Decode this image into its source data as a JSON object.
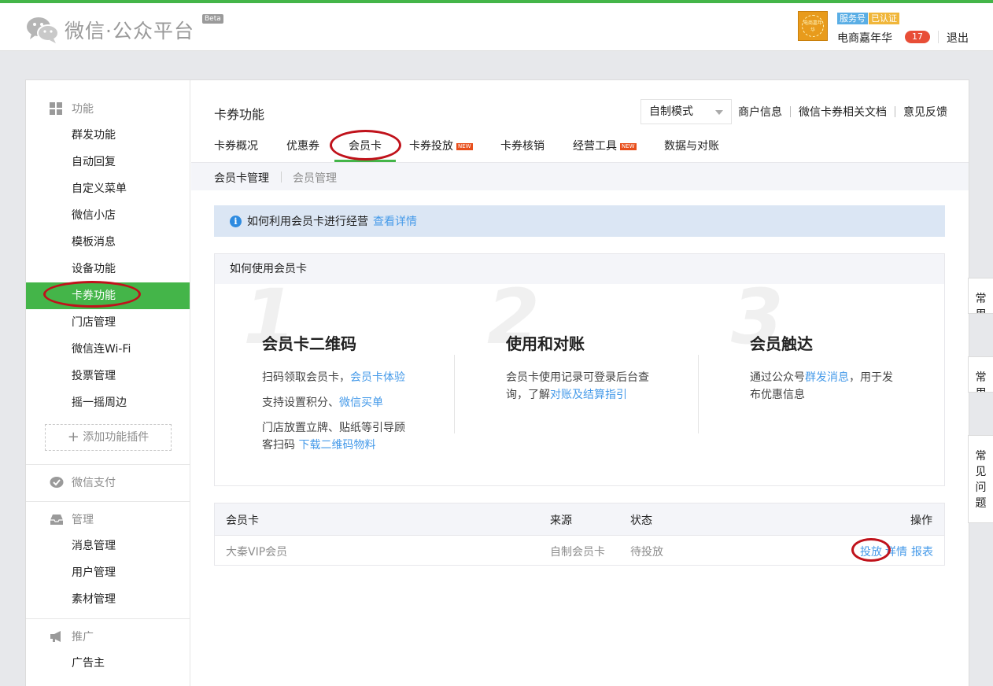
{
  "header": {
    "logo_text": "微信·公众平台",
    "beta": "Beta",
    "avatar_text": "电商嘉年华",
    "badge_service": "服务号",
    "badge_verified": "已认证",
    "account_name": "电商嘉年华",
    "message_count": "17",
    "logout": "退出"
  },
  "sidebar": {
    "group_function": "功能",
    "function_items": [
      "群发功能",
      "自动回复",
      "自定义菜单",
      "微信小店",
      "模板消息",
      "设备功能",
      "卡券功能",
      "门店管理",
      "微信连Wi-Fi",
      "投票管理",
      "摇一摇周边"
    ],
    "add_plugin": "添加功能插件",
    "group_pay": "微信支付",
    "group_manage": "管理",
    "manage_items": [
      "消息管理",
      "用户管理",
      "素材管理"
    ],
    "group_promote": "推广",
    "promote_items": [
      "广告主"
    ]
  },
  "main": {
    "title": "卡券功能",
    "mode_select": "自制模式",
    "top_links": [
      "商户信息",
      "微信卡券相关文档",
      "意见反馈"
    ],
    "tabs": [
      "卡券概况",
      "优惠券",
      "会员卡",
      "卡券投放",
      "卡券核销",
      "经营工具",
      "数据与对账"
    ],
    "new_badge": "NEW",
    "subtabs": [
      "会员卡管理",
      "会员管理"
    ],
    "info_text": "如何利用会员卡进行经营",
    "info_link": "查看详情",
    "howto_title": "如何使用会员卡",
    "steps": [
      {
        "num": "1",
        "title": "会员卡二维码",
        "l1_text": "扫码领取会员卡，",
        "l1_link": "会员卡体验",
        "l2_text": "支持设置积分、",
        "l2_link": "微信买单",
        "l3_text": "门店放置立牌、贴纸等引导顾",
        "l4_text": "客扫码 ",
        "l4_link": "下载二维码物料"
      },
      {
        "num": "2",
        "title": "使用和对账",
        "l1_text": "会员卡使用记录可登录后台查",
        "l2_text": "询，了解",
        "l2_link": "对账及结算指引"
      },
      {
        "num": "3",
        "title": "会员触达",
        "l1_text": "通过公众号",
        "l1_link": "群发消息",
        "l1_tail": "，用于发",
        "l2_text": "布优惠信息"
      }
    ],
    "table": {
      "headers": [
        "会员卡",
        "来源",
        "状态",
        "操作"
      ],
      "row": {
        "name": "大秦VIP会员",
        "source": "自制会员卡",
        "status": "待投放",
        "actions": [
          "投放",
          "详情",
          "报表"
        ]
      }
    }
  },
  "help_tabs": [
    "常用",
    "常用",
    "常见问题"
  ],
  "colors": {
    "accent_green": "#44b549",
    "link_blue": "#459ae9",
    "annotation_red": "#c0121b"
  }
}
